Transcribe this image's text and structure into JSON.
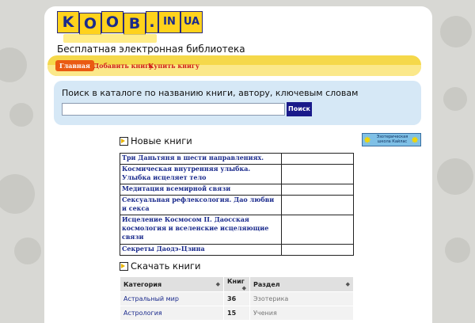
{
  "site": {
    "logo_letters": [
      "K",
      "O",
      "O",
      "B",
      ".",
      "IN",
      "UA"
    ],
    "tagline": "Бесплатная электронная библиотека"
  },
  "nav": {
    "items": [
      "Главная",
      "Добавить книгу",
      "Купить книгу"
    ],
    "active_index": 0
  },
  "search": {
    "title": "Поиск в каталоге по названию книги, автору, ключевым словам",
    "value": "",
    "button_label": "Поиск"
  },
  "new_books": {
    "heading": "Новые книги",
    "rows": [
      "Три Даньтяня в шести направлениях.",
      "Космическая внутренняя улыбка. Улыбка исцеляет тело",
      "Медитация всемирной связи",
      "Сексуальная рефлексология. Дао любви и секса",
      "Исцеление Космосом II. Даосская космология и вселенские исцеляющие связи",
      "Секреты Даодэ-Цзина"
    ]
  },
  "badge": {
    "text": "Эзотерическая школа Кайлас"
  },
  "download": {
    "heading": "Скачать книги",
    "columns": [
      "Категория",
      "Книг",
      "Раздел"
    ],
    "rows": [
      {
        "category": "Астральный мир",
        "count": "36",
        "section": "Эзотерика"
      },
      {
        "category": "Астрология",
        "count": "15",
        "section": "Учения"
      }
    ]
  },
  "colors": {
    "nav_active": "#ea5a12",
    "link": "#1a2a8c",
    "search_button": "#1a1a8a",
    "nav_band": "#f5d84a"
  }
}
